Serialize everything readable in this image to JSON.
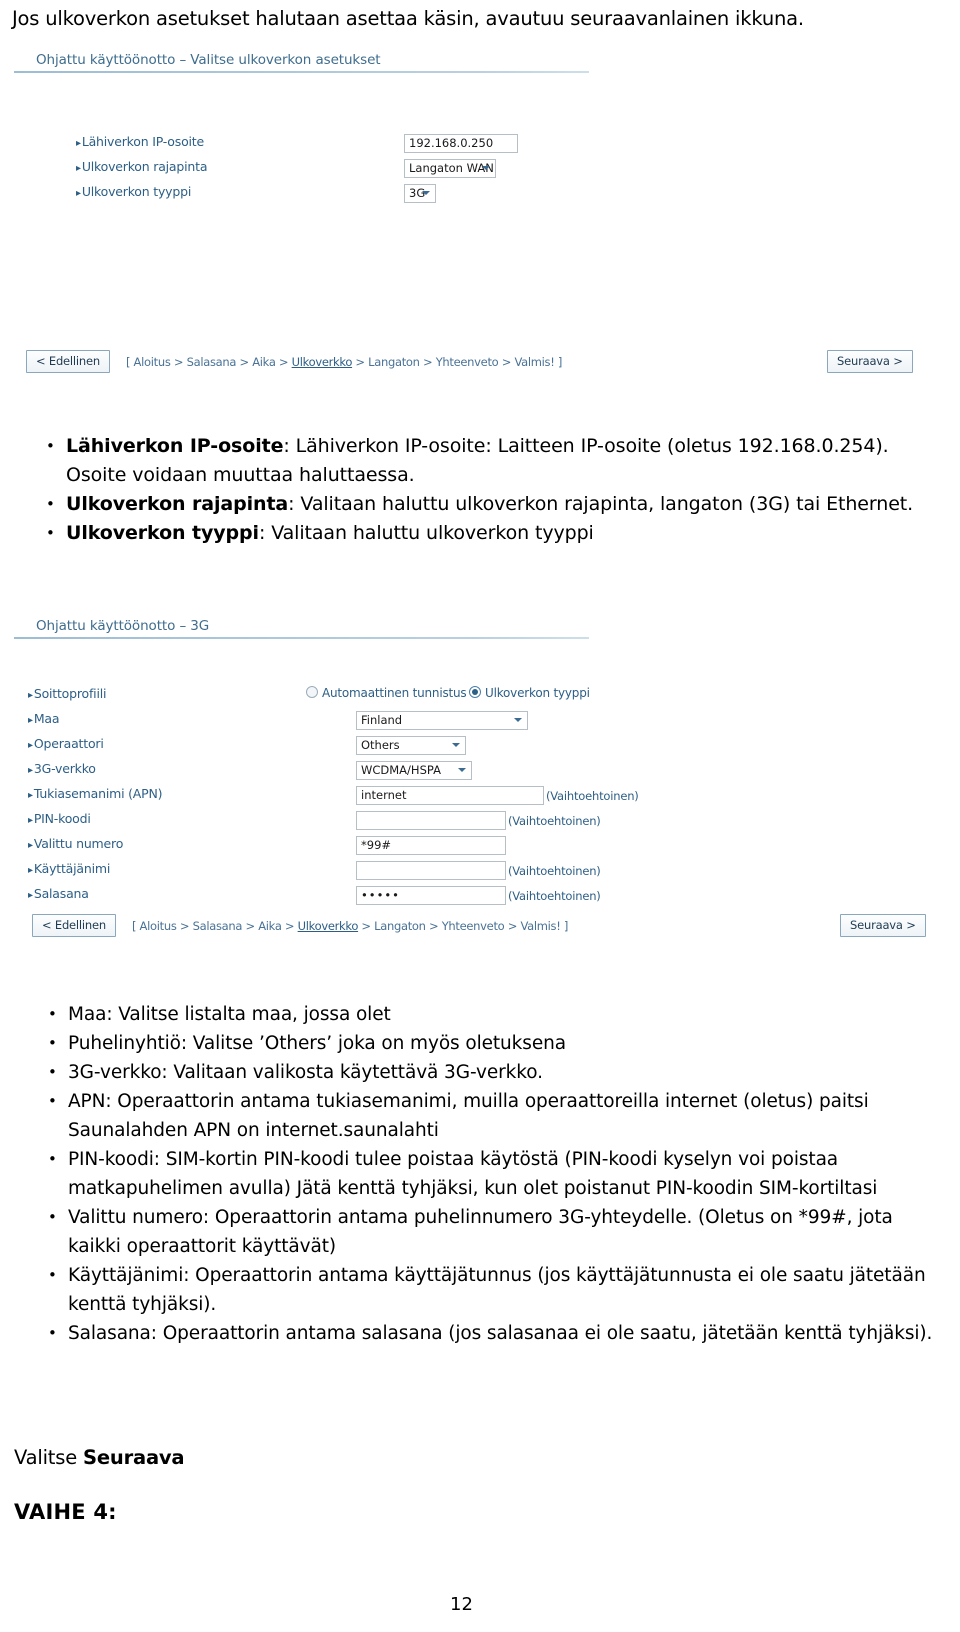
{
  "intro": {
    "text": "Jos ulkoverkon asetukset halutaan asettaa käsin, avautuu seuraavanlainen ikkuna."
  },
  "screenshot1": {
    "title": "Ohjattu käyttöönotto – Valitse ulkoverkon asetukset",
    "rows": [
      {
        "label": "Lähiverkon IP-osoite",
        "type": "text",
        "value": "192.168.0.250"
      },
      {
        "label": "Ulkoverkon rajapinta",
        "type": "select",
        "value": "Langaton WAN"
      },
      {
        "label": "Ulkoverkon tyyppi",
        "type": "select",
        "value": "3G"
      }
    ],
    "nav": {
      "prev_label": "< Edellinen",
      "next_label": "Seuraava >",
      "breadcrumb_open": "[ ",
      "breadcrumb_items": [
        "Aloitus",
        "Salasana",
        "Aika",
        "Ulkoverkko",
        "Langaton",
        "Yhteenveto",
        "Valmis!"
      ],
      "breadcrumb_sep": " > ",
      "breadcrumb_close": " ]",
      "breadcrumb_current": "Ulkoverkko"
    }
  },
  "bullets1": [
    {
      "term": "Lähiverkon IP-osoite",
      "rest": ": Lähiverkon IP-osoite: Laitteen IP-osoite (oletus 192.168.0.254). Osoite voidaan muuttaa haluttaessa."
    },
    {
      "term": "Ulkoverkon rajapinta",
      "rest": ": Valitaan haluttu ulkoverkon rajapinta, langaton (3G) tai Ethernet."
    },
    {
      "term": "Ulkoverkon tyyppi",
      "rest": ": Valitaan haluttu ulkoverkon tyyppi"
    }
  ],
  "screenshot2": {
    "title": "Ohjattu käyttöönotto – 3G",
    "radio_row": {
      "label": "Soittoprofiili",
      "options": [
        {
          "label": "Automaattinen tunnistus",
          "selected": false
        },
        {
          "label": "Ulkoverkon tyyppi",
          "selected": true
        }
      ]
    },
    "rows": [
      {
        "label": "Maa",
        "type": "select",
        "value": "Finland",
        "note": ""
      },
      {
        "label": "Operaattori",
        "type": "select",
        "value": "Others",
        "note": ""
      },
      {
        "label": "3G-verkko",
        "type": "select",
        "value": "WCDMA/HSPA",
        "note": ""
      },
      {
        "label": "Tukiasemanimi (APN)",
        "type": "text",
        "value": "internet",
        "note": "(Vaihtoehtoinen)"
      },
      {
        "label": "PIN-koodi",
        "type": "text",
        "value": "",
        "note": "(Vaihtoehtoinen)"
      },
      {
        "label": "Valittu numero",
        "type": "text",
        "value": "*99#",
        "note": ""
      },
      {
        "label": "Käyttäjänimi",
        "type": "text",
        "value": "",
        "note": "(Vaihtoehtoinen)"
      },
      {
        "label": "Salasana",
        "type": "password",
        "value": "•••••",
        "note": "(Vaihtoehtoinen)"
      }
    ],
    "nav": {
      "prev_label": "< Edellinen",
      "next_label": "Seuraava >",
      "breadcrumb_open": "[ ",
      "breadcrumb_items": [
        "Aloitus",
        "Salasana",
        "Aika",
        "Ulkoverkko",
        "Langaton",
        "Yhteenveto",
        "Valmis!"
      ],
      "breadcrumb_sep": " > ",
      "breadcrumb_close": " ]",
      "breadcrumb_current": "Ulkoverkko"
    }
  },
  "bullets2": [
    "Maa: Valitse listalta maa, jossa olet",
    "Puhelinyhtiö: Valitse ’Others’ joka on myös oletuksena",
    "3G-verkko: Valitaan valikosta käytettävä 3G-verkko.",
    "APN: Operaattorin antama tukiasemanimi, muilla operaattoreilla internet (oletus) paitsi Saunalahden APN on internet.saunalahti",
    "PIN-koodi: SIM-kortin PIN-koodi tulee poistaa käytöstä (PIN-koodi kyselyn voi poistaa matkapuhelimen avulla) Jätä kenttä tyhjäksi, kun olet poistanut PIN-koodin SIM-kortiltasi",
    "Valittu numero: Operaattorin antama puhelinnumero 3G-yhteydelle. (Oletus on *99#, jota kaikki operaattorit käyttävät)",
    "Käyttäjänimi: Operaattorin antama käyttäjätunnus (jos käyttäjätunnusta ei ole saatu jätetään kenttä tyhjäksi).",
    "Salasana: Operaattorin antama salasana (jos salasanaa ei ole saatu, jätetään kenttä tyhjäksi)."
  ],
  "footer": {
    "tagline_prefix": "Valitse ",
    "tagline_bold": "Seuraava",
    "vaihe": "VAIHE 4:",
    "page_number": "12"
  },
  "colors": {
    "panel_label": "#2d5f86",
    "panel_title": "#3f6d8e",
    "rule": "#9dbdd4",
    "field_border": "#b6bfc6"
  }
}
